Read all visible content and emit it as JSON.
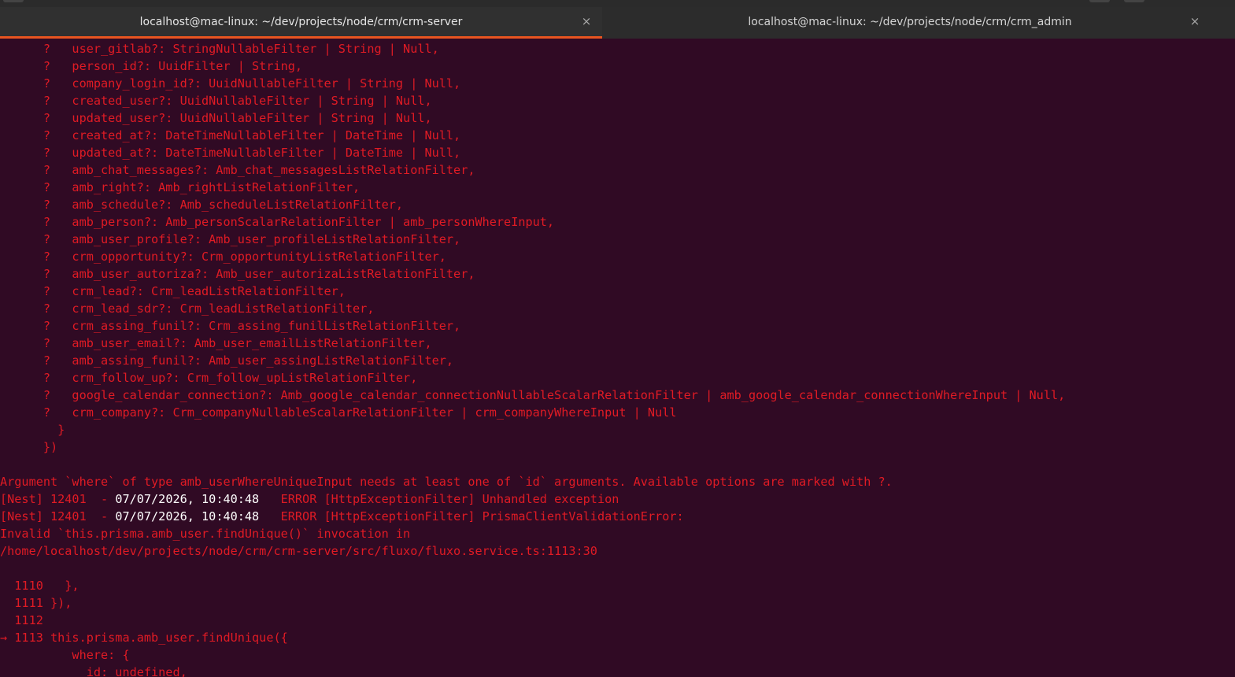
{
  "tabs": [
    {
      "title": "localhost@mac-linux: ~/dev/projects/node/crm/crm-server",
      "close": "×",
      "active": true
    },
    {
      "title": "localhost@mac-linux: ~/dev/projects/node/crm/crm_admin",
      "close": "×",
      "active": false
    }
  ],
  "colors": {
    "background": "#300a24",
    "text_error": "#e01b24",
    "text_white": "#ffffff",
    "tab_accent": "#e95420"
  },
  "terminal": {
    "lines": [
      [
        {
          "t": "      ?   user_gitlab?: StringNullableFilter | String | Null,",
          "c": "red"
        }
      ],
      [
        {
          "t": "      ?   person_id?: UuidFilter | String,",
          "c": "red"
        }
      ],
      [
        {
          "t": "      ?   company_login_id?: UuidNullableFilter | String | Null,",
          "c": "red"
        }
      ],
      [
        {
          "t": "      ?   created_user?: UuidNullableFilter | String | Null,",
          "c": "red"
        }
      ],
      [
        {
          "t": "      ?   updated_user?: UuidNullableFilter | String | Null,",
          "c": "red"
        }
      ],
      [
        {
          "t": "      ?   created_at?: DateTimeNullableFilter | DateTime | Null,",
          "c": "red"
        }
      ],
      [
        {
          "t": "      ?   updated_at?: DateTimeNullableFilter | DateTime | Null,",
          "c": "red"
        }
      ],
      [
        {
          "t": "      ?   amb_chat_messages?: Amb_chat_messagesListRelationFilter,",
          "c": "red"
        }
      ],
      [
        {
          "t": "      ?   amb_right?: Amb_rightListRelationFilter,",
          "c": "red"
        }
      ],
      [
        {
          "t": "      ?   amb_schedule?: Amb_scheduleListRelationFilter,",
          "c": "red"
        }
      ],
      [
        {
          "t": "      ?   amb_person?: Amb_personScalarRelationFilter | amb_personWhereInput,",
          "c": "red"
        }
      ],
      [
        {
          "t": "      ?   amb_user_profile?: Amb_user_profileListRelationFilter,",
          "c": "red"
        }
      ],
      [
        {
          "t": "      ?   crm_opportunity?: Crm_opportunityListRelationFilter,",
          "c": "red"
        }
      ],
      [
        {
          "t": "      ?   amb_user_autoriza?: Amb_user_autorizaListRelationFilter,",
          "c": "red"
        }
      ],
      [
        {
          "t": "      ?   crm_lead?: Crm_leadListRelationFilter,",
          "c": "red"
        }
      ],
      [
        {
          "t": "      ?   crm_lead_sdr?: Crm_leadListRelationFilter,",
          "c": "red"
        }
      ],
      [
        {
          "t": "      ?   crm_assing_funil?: Crm_assing_funilListRelationFilter,",
          "c": "red"
        }
      ],
      [
        {
          "t": "      ?   amb_user_email?: Amb_user_emailListRelationFilter,",
          "c": "red"
        }
      ],
      [
        {
          "t": "      ?   amb_assing_funil?: Amb_user_assingListRelationFilter,",
          "c": "red"
        }
      ],
      [
        {
          "t": "      ?   crm_follow_up?: Crm_follow_upListRelationFilter,",
          "c": "red"
        }
      ],
      [
        {
          "t": "      ?   google_calendar_connection?: Amb_google_calendar_connectionNullableScalarRelationFilter | amb_google_calendar_connectionWhereInput | Null,",
          "c": "red"
        }
      ],
      [
        {
          "t": "      ?   crm_company?: Crm_companyNullableScalarRelationFilter | crm_companyWhereInput | Null",
          "c": "red"
        }
      ],
      [
        {
          "t": "        }",
          "c": "red"
        }
      ],
      [
        {
          "t": "      })",
          "c": "red"
        }
      ],
      [
        {
          "t": "",
          "c": "red"
        }
      ],
      [
        {
          "t": "Argument `where` of type amb_userWhereUniqueInput needs at least one of `id` arguments. Available options are marked with ?.",
          "c": "red"
        }
      ],
      [
        {
          "t": "[Nest] 12401  - ",
          "c": "red"
        },
        {
          "t": "07/07/2026, 10:40:48",
          "c": "white"
        },
        {
          "t": "   ERROR [HttpExceptionFilter] Unhandled exception",
          "c": "red"
        }
      ],
      [
        {
          "t": "[Nest] 12401  - ",
          "c": "red"
        },
        {
          "t": "07/07/2026, 10:40:48",
          "c": "white"
        },
        {
          "t": "   ERROR [HttpExceptionFilter] PrismaClientValidationError:",
          "c": "red"
        }
      ],
      [
        {
          "t": "Invalid `this.prisma.amb_user.findUnique()` invocation in",
          "c": "red"
        }
      ],
      [
        {
          "t": "/home/localhost/dev/projects/node/crm/crm-server/src/fluxo/fluxo.service.ts:1113:30",
          "c": "red"
        }
      ],
      [
        {
          "t": "",
          "c": "red"
        }
      ],
      [
        {
          "t": "  1110   },",
          "c": "red"
        }
      ],
      [
        {
          "t": "  1111 }),",
          "c": "red"
        }
      ],
      [
        {
          "t": "  1112",
          "c": "red"
        }
      ],
      [
        {
          "t": "→ 1113 this.prisma.amb_user.findUnique({",
          "c": "red"
        }
      ],
      [
        {
          "t": "          where: {",
          "c": "red"
        }
      ],
      [
        {
          "t": "            id: undefined,",
          "c": "red"
        }
      ]
    ]
  }
}
